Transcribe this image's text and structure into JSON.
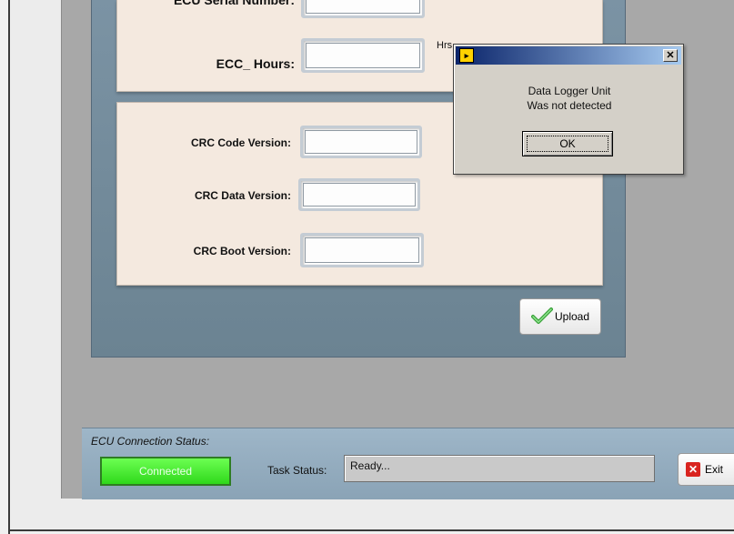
{
  "ecu_panel": {
    "serial_label": "ECU Serial Number:",
    "hours_label": "ECC_ Hours:",
    "hours_unit": "Hrs",
    "serial_value": "",
    "hours_value": ""
  },
  "crc_panel": {
    "code_label": "CRC Code Version:",
    "data_label": "CRC Data Version:",
    "boot_label": "CRC Boot Version:",
    "code_value": "",
    "data_value": "",
    "boot_value": ""
  },
  "upload_button": {
    "label": "Upload",
    "icon": "checkmark-icon"
  },
  "status": {
    "connection_title": "ECU Connection Status:",
    "connection_value": "Connected",
    "connection_color": "#3be826",
    "task_label": "Task Status:",
    "task_value": "Ready..."
  },
  "exit_button": {
    "label": "Exit",
    "icon": "red-x-icon"
  },
  "dialog": {
    "title": "",
    "message_line1": "Data Logger Unit",
    "message_line2": "Was not detected",
    "ok_label": "OK",
    "close_glyph": "✕"
  }
}
